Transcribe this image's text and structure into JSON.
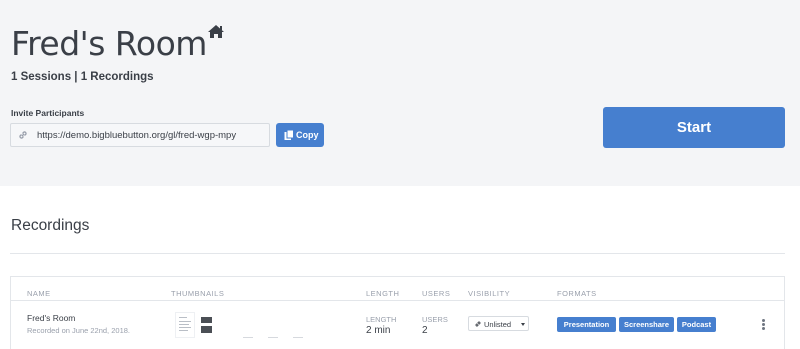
{
  "room": {
    "title": "Fred's Room",
    "stats": "1 Sessions | 1 Recordings",
    "home_icon": "home-icon"
  },
  "invite": {
    "label": "Invite Participants",
    "url": "https://demo.bigbluebutton.org/gl/fred-wgp-mpy",
    "copy_label": "Copy"
  },
  "start_label": "Start",
  "recordings": {
    "title": "Recordings",
    "columns": [
      "NAME",
      "THUMBNAILS",
      "LENGTH",
      "USERS",
      "VISIBILITY",
      "FORMATS"
    ],
    "rows": [
      {
        "name": "Fred's Room",
        "recorded": "Recorded on June 22nd, 2018.",
        "length_label": "LENGTH",
        "length": "2 min",
        "users_label": "USERS",
        "users": "2",
        "visibility": "Unlisted",
        "formats": [
          "Presentation",
          "Screenshare",
          "Podcast"
        ]
      }
    ]
  },
  "colors": {
    "accent": "#467fcf",
    "header_bg": "#f4f5f7",
    "text": "#3a3f47",
    "muted": "#9aa0ac"
  }
}
